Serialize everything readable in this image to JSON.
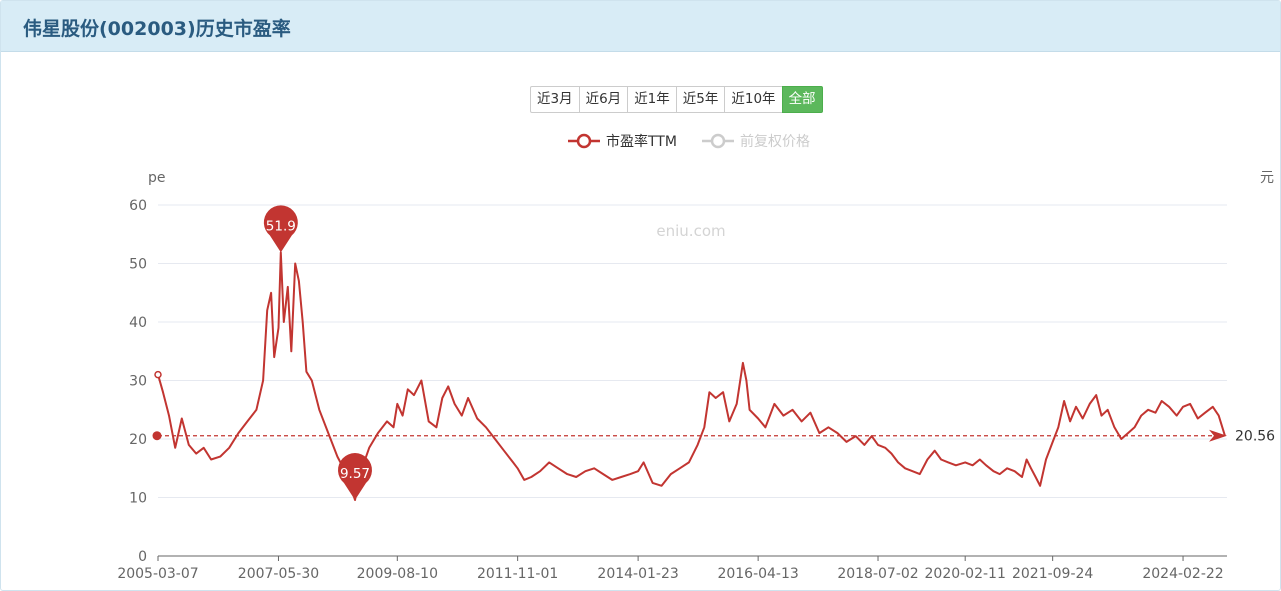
{
  "page": {
    "title": "伟星股份(002003)历史市盈率"
  },
  "range_buttons": [
    "近3月",
    "近6月",
    "近1年",
    "近5年",
    "近10年",
    "全部"
  ],
  "active_range": "全部",
  "watermark": "eniu.com",
  "colors": {
    "pe": "#c23531",
    "price_inactive": "#cccccc",
    "button_active": "#5cb85c",
    "header_bg": "#d8ecf6",
    "title": "#2a5b80"
  },
  "chart_data": {
    "type": "line",
    "left_axis_name": "pe",
    "right_axis_name": "元",
    "ylim": [
      0,
      60
    ],
    "y_ticks": [
      0,
      10,
      20,
      30,
      40,
      50,
      60
    ],
    "x_ticks": [
      "2005-03-07",
      "2007-05-30",
      "2009-08-10",
      "2011-11-01",
      "2014-01-23",
      "2016-04-13",
      "2018-07-02",
      "2020-02-11",
      "2021-09-24",
      "2024-02-22"
    ],
    "grid": true,
    "legend_position": "top-center",
    "series": [
      {
        "name": "市盈率TTM",
        "active": true,
        "points": [
          [
            "2005-03-07",
            31.0
          ],
          [
            "2005-04-10",
            28.0
          ],
          [
            "2005-05-20",
            24.0
          ],
          [
            "2005-07-01",
            18.5
          ],
          [
            "2005-08-15",
            23.5
          ],
          [
            "2005-10-01",
            19.0
          ],
          [
            "2005-11-20",
            17.5
          ],
          [
            "2006-01-10",
            18.5
          ],
          [
            "2006-03-01",
            16.5
          ],
          [
            "2006-05-01",
            17.0
          ],
          [
            "2006-07-01",
            18.5
          ],
          [
            "2006-09-01",
            21.0
          ],
          [
            "2006-11-01",
            23.0
          ],
          [
            "2007-01-01",
            25.0
          ],
          [
            "2007-02-15",
            30.0
          ],
          [
            "2007-03-15",
            42.0
          ],
          [
            "2007-04-10",
            45.0
          ],
          [
            "2007-05-01",
            34.0
          ],
          [
            "2007-05-30",
            39.0
          ],
          [
            "2007-06-15",
            51.9
          ],
          [
            "2007-07-05",
            40.0
          ],
          [
            "2007-08-01",
            46.0
          ],
          [
            "2007-08-25",
            35.0
          ],
          [
            "2007-09-20",
            50.0
          ],
          [
            "2007-10-15",
            47.0
          ],
          [
            "2007-11-10",
            40.0
          ],
          [
            "2007-12-05",
            31.5
          ],
          [
            "2008-01-10",
            30.0
          ],
          [
            "2008-03-01",
            25.0
          ],
          [
            "2008-05-01",
            21.0
          ],
          [
            "2008-07-01",
            17.0
          ],
          [
            "2008-09-01",
            14.0
          ],
          [
            "2008-10-28",
            9.57
          ],
          [
            "2008-12-01",
            14.0
          ],
          [
            "2009-02-01",
            18.5
          ],
          [
            "2009-04-01",
            21.0
          ],
          [
            "2009-06-01",
            23.0
          ],
          [
            "2009-07-15",
            22.0
          ],
          [
            "2009-08-10",
            26.0
          ],
          [
            "2009-09-15",
            24.0
          ],
          [
            "2009-10-20",
            28.5
          ],
          [
            "2009-12-01",
            27.5
          ],
          [
            "2010-01-20",
            30.0
          ],
          [
            "2010-03-10",
            23.0
          ],
          [
            "2010-05-01",
            22.0
          ],
          [
            "2010-06-10",
            27.0
          ],
          [
            "2010-07-20",
            29.0
          ],
          [
            "2010-09-01",
            26.0
          ],
          [
            "2010-10-20",
            24.0
          ],
          [
            "2010-12-01",
            27.0
          ],
          [
            "2011-02-01",
            23.5
          ],
          [
            "2011-04-01",
            22.0
          ],
          [
            "2011-06-01",
            20.0
          ],
          [
            "2011-08-01",
            18.0
          ],
          [
            "2011-10-01",
            16.0
          ],
          [
            "2011-11-01",
            15.0
          ],
          [
            "2011-12-15",
            13.0
          ],
          [
            "2012-02-01",
            13.5
          ],
          [
            "2012-04-01",
            14.5
          ],
          [
            "2012-06-01",
            16.0
          ],
          [
            "2012-08-01",
            15.0
          ],
          [
            "2012-10-01",
            14.0
          ],
          [
            "2012-12-01",
            13.5
          ],
          [
            "2013-02-01",
            14.5
          ],
          [
            "2013-04-01",
            15.0
          ],
          [
            "2013-06-01",
            14.0
          ],
          [
            "2013-08-01",
            13.0
          ],
          [
            "2013-10-01",
            13.5
          ],
          [
            "2013-12-01",
            14.0
          ],
          [
            "2014-01-23",
            14.5
          ],
          [
            "2014-03-01",
            16.0
          ],
          [
            "2014-05-01",
            12.5
          ],
          [
            "2014-07-01",
            12.0
          ],
          [
            "2014-09-01",
            14.0
          ],
          [
            "2014-11-01",
            15.0
          ],
          [
            "2015-01-01",
            16.0
          ],
          [
            "2015-03-01",
            19.0
          ],
          [
            "2015-04-15",
            22.0
          ],
          [
            "2015-05-20",
            28.0
          ],
          [
            "2015-07-01",
            27.0
          ],
          [
            "2015-08-20",
            28.0
          ],
          [
            "2015-10-01",
            23.0
          ],
          [
            "2015-11-20",
            26.0
          ],
          [
            "2016-01-01",
            33.0
          ],
          [
            "2016-01-25",
            30.0
          ],
          [
            "2016-02-15",
            25.0
          ],
          [
            "2016-04-13",
            23.5
          ],
          [
            "2016-06-01",
            22.0
          ],
          [
            "2016-08-01",
            26.0
          ],
          [
            "2016-10-01",
            24.0
          ],
          [
            "2016-12-01",
            25.0
          ],
          [
            "2017-02-01",
            23.0
          ],
          [
            "2017-04-01",
            24.5
          ],
          [
            "2017-06-01",
            21.0
          ],
          [
            "2017-08-01",
            22.0
          ],
          [
            "2017-10-01",
            21.0
          ],
          [
            "2017-12-01",
            19.5
          ],
          [
            "2018-02-01",
            20.5
          ],
          [
            "2018-04-01",
            19.0
          ],
          [
            "2018-05-20",
            20.5
          ],
          [
            "2018-07-02",
            19.0
          ],
          [
            "2018-08-20",
            18.5
          ],
          [
            "2018-10-01",
            17.5
          ],
          [
            "2018-11-15",
            16.0
          ],
          [
            "2019-01-01",
            15.0
          ],
          [
            "2019-02-20",
            14.5
          ],
          [
            "2019-04-10",
            14.0
          ],
          [
            "2019-06-01",
            16.5
          ],
          [
            "2019-07-20",
            18.0
          ],
          [
            "2019-09-01",
            16.5
          ],
          [
            "2019-10-20",
            16.0
          ],
          [
            "2019-12-10",
            15.5
          ],
          [
            "2020-02-11",
            16.0
          ],
          [
            "2020-04-01",
            15.5
          ],
          [
            "2020-05-20",
            16.5
          ],
          [
            "2020-07-01",
            15.5
          ],
          [
            "2020-08-20",
            14.5
          ],
          [
            "2020-10-01",
            14.0
          ],
          [
            "2020-11-20",
            15.0
          ],
          [
            "2021-01-10",
            14.5
          ],
          [
            "2021-03-01",
            13.5
          ],
          [
            "2021-04-01",
            16.5
          ],
          [
            "2021-05-01",
            15.0
          ],
          [
            "2021-06-01",
            13.5
          ],
          [
            "2021-07-01",
            12.0
          ],
          [
            "2021-08-10",
            16.5
          ],
          [
            "2021-09-24",
            19.5
          ],
          [
            "2021-11-01",
            22.0
          ],
          [
            "2021-12-10",
            26.5
          ],
          [
            "2022-01-20",
            23.0
          ],
          [
            "2022-03-01",
            25.5
          ],
          [
            "2022-04-15",
            23.5
          ],
          [
            "2022-06-01",
            26.0
          ],
          [
            "2022-07-15",
            27.5
          ],
          [
            "2022-08-20",
            24.0
          ],
          [
            "2022-10-01",
            25.0
          ],
          [
            "2022-11-15",
            22.0
          ],
          [
            "2023-01-01",
            20.0
          ],
          [
            "2023-02-15",
            21.0
          ],
          [
            "2023-04-01",
            22.0
          ],
          [
            "2023-05-15",
            24.0
          ],
          [
            "2023-07-01",
            25.0
          ],
          [
            "2023-08-20",
            24.5
          ],
          [
            "2023-10-01",
            26.5
          ],
          [
            "2023-11-20",
            25.5
          ],
          [
            "2024-01-10",
            24.0
          ],
          [
            "2024-02-22",
            25.5
          ],
          [
            "2024-04-10",
            26.0
          ],
          [
            "2024-06-01",
            23.5
          ],
          [
            "2024-07-20",
            24.5
          ],
          [
            "2024-09-10",
            25.5
          ],
          [
            "2024-10-20",
            24.0
          ],
          [
            "2024-12-01",
            20.56
          ]
        ]
      },
      {
        "name": "前复权价格",
        "active": false,
        "points": []
      }
    ],
    "markers": [
      {
        "label": "51.9",
        "date": "2007-06-15",
        "value": 51.9,
        "kind": "max"
      },
      {
        "label": "9.57",
        "date": "2008-10-28",
        "value": 9.57,
        "kind": "min"
      }
    ],
    "reference_line": {
      "label": "20.56",
      "value": 20.56
    }
  }
}
